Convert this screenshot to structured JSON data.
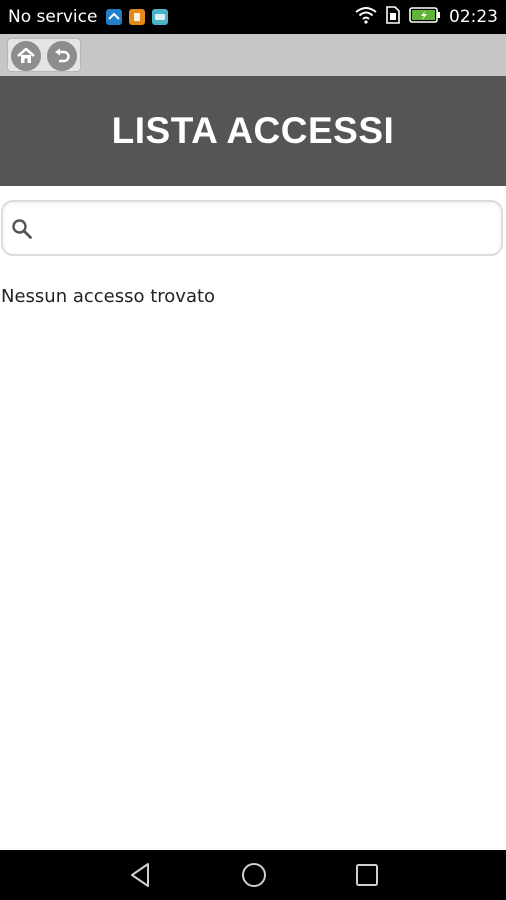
{
  "status_bar": {
    "carrier": "No service",
    "time": "02:23",
    "notification_icons": [
      "app-icon-blue",
      "app-icon-orange",
      "app-icon-cyan"
    ],
    "system_icons": [
      "wifi-icon",
      "sim-icon",
      "battery-charging-icon"
    ]
  },
  "toolbar": {
    "home_icon": "home-icon",
    "back_icon": "back-arrow-icon"
  },
  "header": {
    "title": "LISTA ACCESSI"
  },
  "search": {
    "value": "",
    "placeholder": "",
    "icon": "search-icon"
  },
  "list": {
    "empty_message": "Nessun accesso trovato"
  },
  "colors": {
    "header_bg": "#555555",
    "toolbar_bg": "#c6c6c6",
    "status_bar_bg": "#000000",
    "battery_green": "#5fb336"
  }
}
